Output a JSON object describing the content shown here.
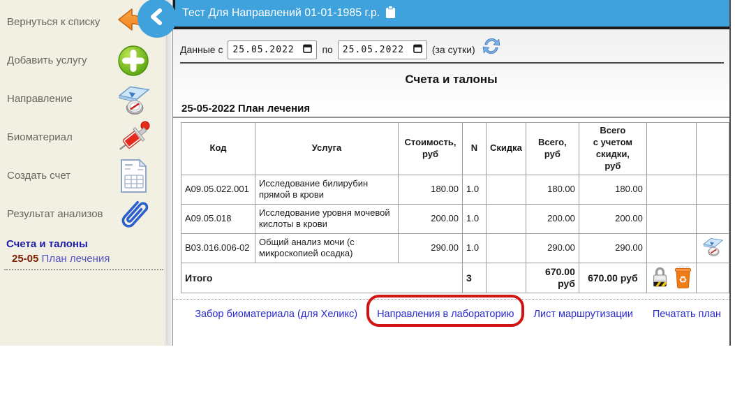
{
  "sidebar": {
    "items": [
      {
        "label": "Вернуться к списку",
        "icon": "back-arrow-icon"
      },
      {
        "label": "Добавить услугу",
        "icon": "add-plus-icon"
      },
      {
        "label": "Направление",
        "icon": "compass-icon"
      },
      {
        "label": "Биоматериал",
        "icon": "syringe-icon"
      },
      {
        "label": "Создать счет",
        "icon": "invoice-icon"
      },
      {
        "label": "Результат анализов",
        "icon": "paperclip-icon"
      }
    ],
    "section_title": "Счета и талоны",
    "sub_item": {
      "date": "25-05",
      "label": "План лечения"
    }
  },
  "header": {
    "patient_title": "Тест Для Направлений 01-01-1985 г.р.",
    "icon": "clipboard-icon"
  },
  "filter": {
    "label_from": "Данные с",
    "date_from": "25.05.2022",
    "label_to": "по",
    "date_to": "25.05.2022",
    "suffix": "(за сутки)",
    "refresh_icon": "refresh-icon"
  },
  "main": {
    "title": "Счета и талоны",
    "subtitle": "25-05-2022 План лечения"
  },
  "table": {
    "headers": [
      "Код",
      "Услуга",
      "Стоимость,\nруб",
      "N",
      "Скидка",
      "Всего,\nруб",
      "Всего\nс учетом\nскидки,\nруб",
      "",
      ""
    ],
    "rows": [
      {
        "code": "A09.05.022.001",
        "service": "Исследование билирубин прямой в крови",
        "price": "180.00",
        "n": "1.0",
        "discount": "",
        "total": "180.00",
        "total_with_discount": "180.00"
      },
      {
        "code": "A09.05.018",
        "service": "Исследование уровня мочевой кислоты в крови",
        "price": "200.00",
        "n": "1.0",
        "discount": "",
        "total": "200.00",
        "total_with_discount": "200.00"
      },
      {
        "code": "B03.016.006-02",
        "service": "Общий анализ мочи (с микроскопией осадка)",
        "price": "290.00",
        "n": "1.0",
        "discount": "",
        "total": "290.00",
        "total_with_discount": "290.00"
      }
    ],
    "total_row": {
      "label": "Итого",
      "n": "3",
      "total": "670.00 руб",
      "total_with_discount": "670.00 руб"
    },
    "row_icons": {
      "referral": "compass-icon",
      "lock": "lock-icon",
      "delete": "trash-icon"
    }
  },
  "footer_links": [
    "Забор биоматериала (для Хеликс)",
    "Направления в лабораторию",
    "Лист маршрутизации",
    "Печатать план"
  ],
  "annotation": {
    "target": "Направления в лабораторию",
    "shape": "red-rounded-rectangle"
  },
  "colors": {
    "header_blue": "#3fa2dc",
    "sidebar_bg": "#f2f0e3",
    "link_blue": "#2b2bd0",
    "annotation_red": "#d01414",
    "section_title_blue": "#1c1ca8",
    "sub_date_maroon": "#7b1d00"
  }
}
